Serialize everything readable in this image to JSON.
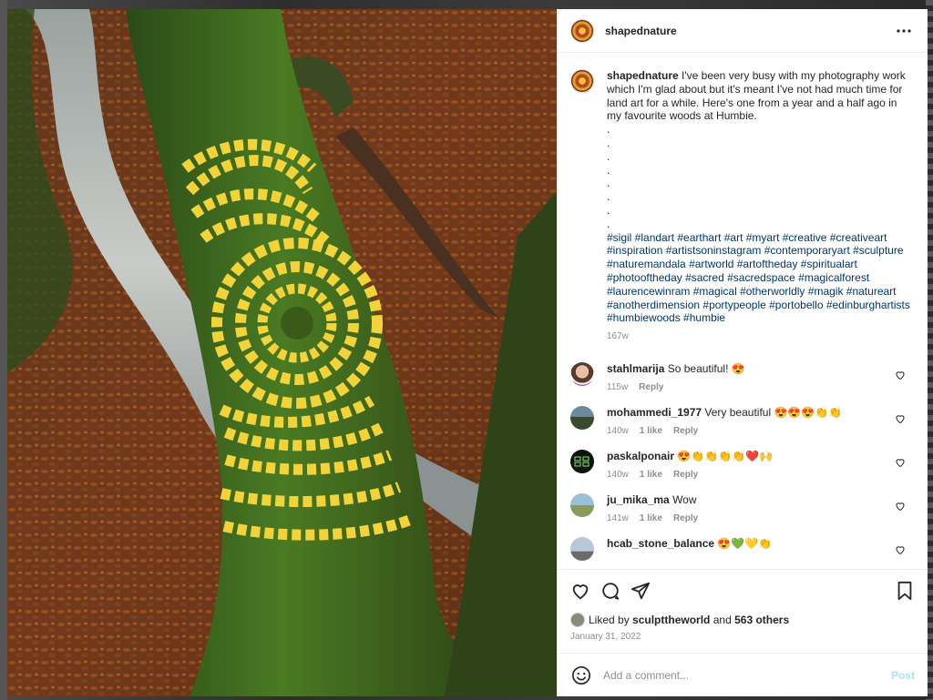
{
  "post": {
    "author": "shapednature",
    "caption": "I've been very busy with my photography work which I'm glad about but it's meant I've not had much time for land art for a while. Here's one from a year and a half ago in my favourite woods at Humbie.",
    "dots": [
      ".",
      ".",
      ".",
      ".",
      ".",
      ".",
      ".",
      "."
    ],
    "hashtags": "#sigil #landart #earthart #art #myart #creative #creativeart #inspiration #artistsoninstagram #contemporaryart #sculpture #naturemandala #artworld #artoftheday #spiritualart #photooftheday #sacred #sacredspace #magicalforest #laurencewinram #magical #otherworldly #magik #natureart #anotherdimension #portypeople #portobello #edinburghartists #humbiewoods #humbie",
    "age": "167w"
  },
  "comments": [
    {
      "user": "stahlmarija",
      "text": "So beautiful! 😍",
      "age": "115w",
      "likes": "",
      "reply": "Reply"
    },
    {
      "user": "mohammedi_1977",
      "text": "Very beautiful 😍😍😍👏👏",
      "age": "140w",
      "likes": "1 like",
      "reply": "Reply"
    },
    {
      "user": "paskalponair",
      "text": "😍👏👏👏👏❤️🙌",
      "age": "140w",
      "likes": "1 like",
      "reply": "Reply"
    },
    {
      "user": "ju_mika_ma",
      "text": "Wow",
      "age": "141w",
      "likes": "1 like",
      "reply": "Reply"
    },
    {
      "user": "hcab_stone_balance",
      "text": "😍💚💛👏",
      "age": "",
      "likes": "",
      "reply": ""
    }
  ],
  "likes": {
    "prefix": "Liked by",
    "user": "sculpttheworld",
    "and": "and",
    "others": "563 others"
  },
  "date": "January 31, 2022",
  "add_comment": {
    "placeholder": "Add a comment...",
    "post_label": "Post"
  },
  "icons": {
    "more": "more-options-icon",
    "like": "heart-icon",
    "comment": "comment-icon",
    "share": "share-icon",
    "save": "bookmark-icon",
    "emoji": "emoji-icon"
  },
  "colors": {
    "link": "#00376b",
    "muted": "#8e8e8e",
    "post_button": "#b2dffc"
  }
}
